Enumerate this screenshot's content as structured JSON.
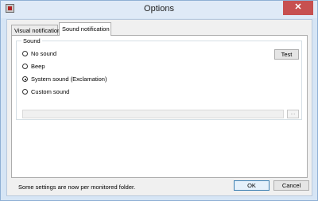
{
  "window": {
    "title": "Options",
    "icon": "app-icon",
    "close_glyph": "✕"
  },
  "tabs": [
    {
      "label": "Visual notification",
      "selected": false
    },
    {
      "label": "Sound notification",
      "selected": true
    }
  ],
  "sound_group": {
    "label": "Sound",
    "options": [
      {
        "label": "No sound",
        "checked": false
      },
      {
        "label": "Beep",
        "checked": false
      },
      {
        "label": "System sound (Exclamation)",
        "checked": true
      },
      {
        "label": "Custom sound",
        "checked": false
      }
    ],
    "test_label": "Test",
    "custom_path_value": "",
    "browse_label": "..."
  },
  "footer": {
    "note": "Some settings are now per monitored folder.",
    "ok_label": "OK",
    "cancel_label": "Cancel"
  }
}
